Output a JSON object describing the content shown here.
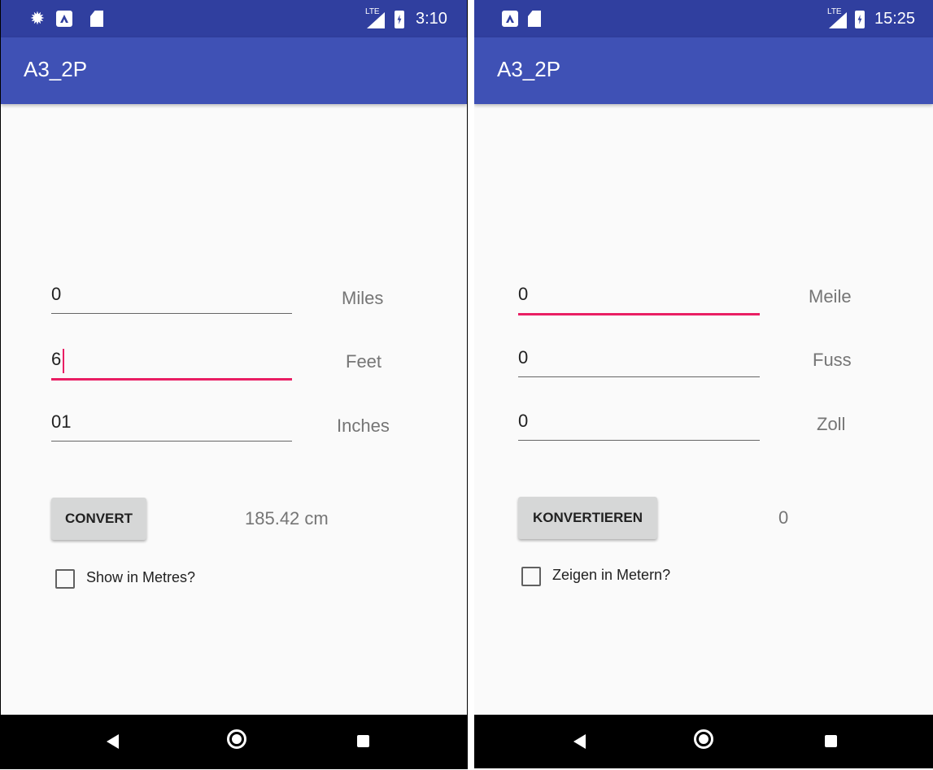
{
  "phones": {
    "en": {
      "status_bar": {
        "time": "3:10",
        "network": "LTE",
        "icons": [
          "gear-icon",
          "a-icon",
          "sd-card-icon",
          "signal-icon",
          "battery-icon"
        ]
      },
      "app_title": "A3_2P",
      "fields": [
        {
          "value": "0",
          "unit": "Miles"
        },
        {
          "value": "6",
          "unit": "Feet",
          "focused": true
        },
        {
          "value": "01",
          "unit": "Inches"
        }
      ],
      "convert_label": "CONVERT",
      "result": "185.42 cm",
      "checkbox_label": "Show in Metres?",
      "checkbox_checked": false
    },
    "de": {
      "status_bar": {
        "time": "15:25",
        "network": "LTE",
        "icons": [
          "a-icon",
          "sd-card-icon",
          "signal-icon",
          "battery-icon"
        ]
      },
      "app_title": "A3_2P",
      "fields": [
        {
          "value": "0",
          "unit": "Meile",
          "focused": true
        },
        {
          "value": "0",
          "unit": "Fuss"
        },
        {
          "value": "0",
          "unit": "Zoll"
        }
      ],
      "convert_label": "KONVERTIEREN",
      "result": "0",
      "checkbox_label": "Zeigen in Metern?",
      "checkbox_checked": false
    }
  },
  "colors": {
    "status_bar": "#303f9f",
    "app_bar": "#3f51b5",
    "accent": "#e91e63",
    "background": "#fafafa",
    "button": "#d6d7d7",
    "nav_bar": "#000000"
  },
  "nav_icons": [
    "back-icon",
    "home-icon",
    "recent-apps-icon"
  ]
}
